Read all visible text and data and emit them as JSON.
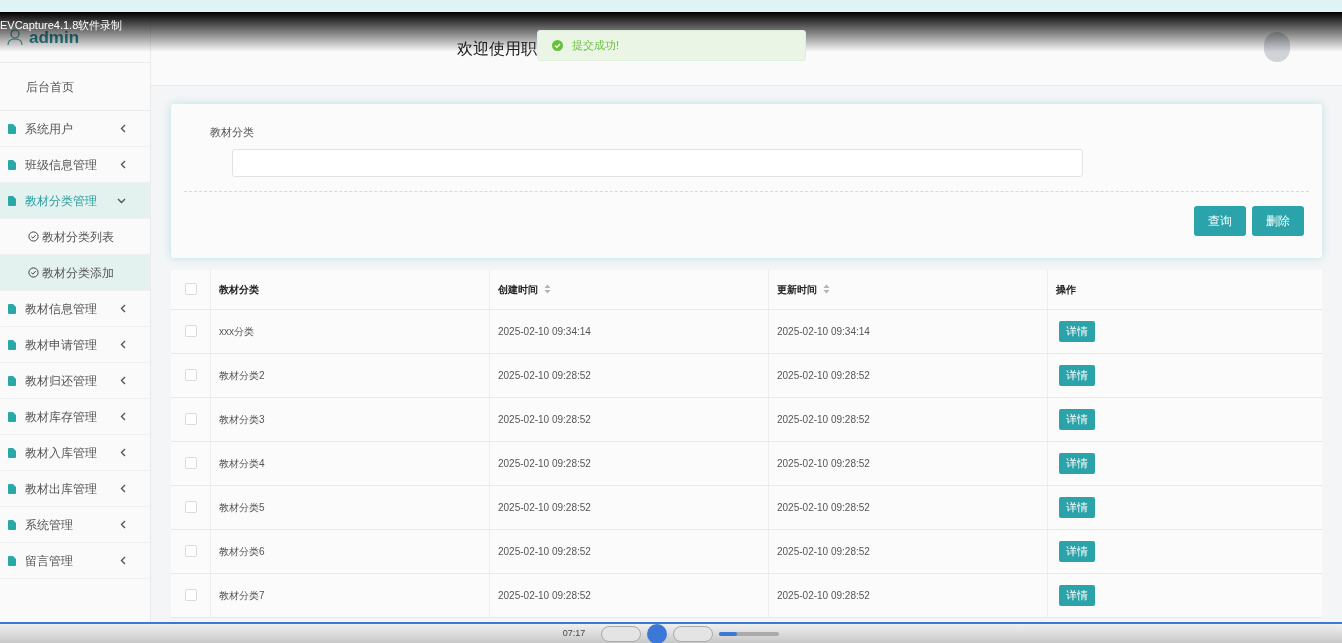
{
  "recorder": {
    "label": "EVCapture4.1.8软件录制",
    "time": "07:17",
    "volume": {
      "level": 0.3
    }
  },
  "sidebar": {
    "user": "admin",
    "home": "后台首页",
    "items": [
      {
        "label": "系统用户",
        "expanded": false,
        "selected": false
      },
      {
        "label": "班级信息管理",
        "expanded": false,
        "selected": false
      },
      {
        "label": "教材分类管理",
        "expanded": true,
        "selected": true,
        "children": [
          {
            "label": "教材分类列表",
            "selected": false
          },
          {
            "label": "教材分类添加",
            "selected": true
          }
        ]
      },
      {
        "label": "教材信息管理",
        "expanded": false,
        "selected": false
      },
      {
        "label": "教材申请管理",
        "expanded": false,
        "selected": false
      },
      {
        "label": "教材归还管理",
        "expanded": false,
        "selected": false
      },
      {
        "label": "教材库存管理",
        "expanded": false,
        "selected": false
      },
      {
        "label": "教材入库管理",
        "expanded": false,
        "selected": false
      },
      {
        "label": "教材出库管理",
        "expanded": false,
        "selected": false
      },
      {
        "label": "系统管理",
        "expanded": false,
        "selected": false
      },
      {
        "label": "留言管理",
        "expanded": false,
        "selected": false
      }
    ]
  },
  "header": {
    "title": "欢迎使用职",
    "toast": "提交成功!"
  },
  "search": {
    "label": "教材分类",
    "buttons": [
      "查询",
      "删除"
    ]
  },
  "table": {
    "select_all": {
      "checked": false
    },
    "columns": [
      {
        "label": "教材分类",
        "sortable": false
      },
      {
        "label": "创建时间",
        "sortable": true
      },
      {
        "label": "更新时间",
        "sortable": true
      },
      {
        "label": "操作",
        "sortable": false
      }
    ],
    "rows": [
      {
        "checked": false,
        "cells": [
          "xxx分类",
          "2025-02-10 09:34:14",
          "2025-02-10 09:34:14"
        ],
        "action": "详情"
      },
      {
        "checked": false,
        "cells": [
          "教材分类2",
          "2025-02-10 09:28:52",
          "2025-02-10 09:28:52"
        ],
        "action": "详情"
      },
      {
        "checked": false,
        "cells": [
          "教材分类3",
          "2025-02-10 09:28:52",
          "2025-02-10 09:28:52"
        ],
        "action": "详情"
      },
      {
        "checked": false,
        "cells": [
          "教材分类4",
          "2025-02-10 09:28:52",
          "2025-02-10 09:28:52"
        ],
        "action": "详情"
      },
      {
        "checked": false,
        "cells": [
          "教材分类5",
          "2025-02-10 09:28:52",
          "2025-02-10 09:28:52"
        ],
        "action": "详情"
      },
      {
        "checked": false,
        "cells": [
          "教材分类6",
          "2025-02-10 09:28:52",
          "2025-02-10 09:28:52"
        ],
        "action": "详情"
      },
      {
        "checked": false,
        "cells": [
          "教材分类7",
          "2025-02-10 09:28:52",
          "2025-02-10 09:28:52"
        ],
        "action": "详情"
      }
    ]
  }
}
